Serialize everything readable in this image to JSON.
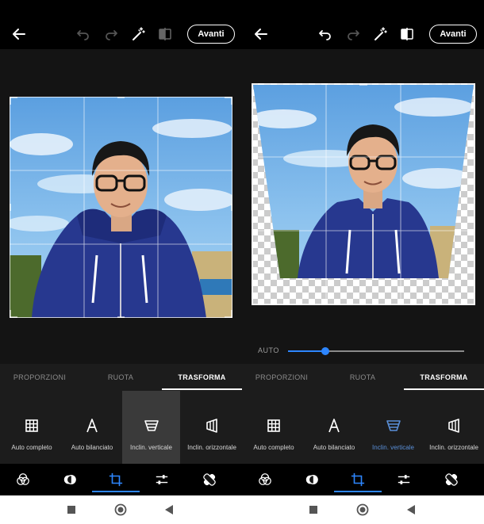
{
  "screens": [
    {
      "id": "left",
      "avanti_label": "Avanti",
      "slider": null,
      "tabs": [
        {
          "label": "PROPORZIONI",
          "active": false
        },
        {
          "label": "RUOTA",
          "active": false
        },
        {
          "label": "TRASFORMA",
          "active": true
        }
      ],
      "tools": [
        {
          "label": "Auto completo",
          "icon": "grid-icon",
          "selected": false,
          "highlight_bg": false
        },
        {
          "label": "Auto bilanciato",
          "icon": "letter-a-icon",
          "selected": false,
          "highlight_bg": false
        },
        {
          "label": "Inclin. verticale",
          "icon": "vertical-tilt-icon",
          "selected": true,
          "highlight_bg": true
        },
        {
          "label": "Inclin. orizzontale",
          "icon": "horizontal-tilt-icon",
          "selected": false,
          "highlight_bg": false
        }
      ]
    },
    {
      "id": "right",
      "avanti_label": "Avanti",
      "slider": {
        "label": "AUTO",
        "value": 0.21
      },
      "tabs": [
        {
          "label": "PROPORZIONI",
          "active": false
        },
        {
          "label": "RUOTA",
          "active": false
        },
        {
          "label": "TRASFORMA",
          "active": true
        }
      ],
      "tools": [
        {
          "label": "Auto completo",
          "icon": "grid-icon",
          "selected": false,
          "highlight_bg": false
        },
        {
          "label": "Auto bilanciato",
          "icon": "letter-a-icon",
          "selected": false,
          "highlight_bg": false
        },
        {
          "label": "Inclin. verticale",
          "icon": "vertical-tilt-icon",
          "selected": true,
          "highlight_bg": false
        },
        {
          "label": "Inclin. orizzontale",
          "icon": "horizontal-tilt-icon",
          "selected": false,
          "highlight_bg": false
        }
      ]
    }
  ],
  "top_icons": [
    "back-arrow-icon",
    "undo-icon",
    "redo-icon",
    "magic-wand-icon",
    "compare-icon"
  ],
  "bottom_nav_icons": [
    "looks-icon",
    "filters-icon",
    "crop-icon",
    "adjustments-icon",
    "healing-icon"
  ],
  "system_nav_icons": [
    "recents-square-icon",
    "home-circle-icon",
    "back-triangle-icon"
  ],
  "colors": {
    "accent": "#2d86ff",
    "selected_tool_label": "#5a8fd8",
    "panel_bg": "#141414",
    "tools_bg": "#1c1c1c",
    "topbar_bg": "#000000"
  }
}
